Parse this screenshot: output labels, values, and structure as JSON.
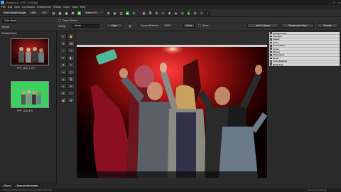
{
  "window": {
    "title": "Photokey 8 - [FPP_0138.jpg]",
    "controls": [
      "–",
      "□",
      "×"
    ]
  },
  "menu": [
    "File",
    "Edit",
    "View",
    "Corrections",
    "Environment",
    "Effects",
    "Layer",
    "Tools",
    "Help"
  ],
  "toolbar": {
    "mode": "Select Multiple Images",
    "width": "1280",
    "height": "720",
    "zoom": "Scale to Fit"
  },
  "subtoolbar": {
    "label_color": "Color Match",
    "label_despill": "Despill",
    "label_setting": "Setting",
    "setting_value": "Whole",
    "screen_checkbox_label": "Green Screen",
    "open_button": "Open",
    "current_selection_label": "Current Selection",
    "current_selection_value": "GREE",
    "clear_button": "Clear",
    "same_label": "Same",
    "add_to_queue": "Add To Queue",
    "synchronize": "Synchronize Keys",
    "browse": "Browse"
  },
  "left_panel": {
    "title": "Selected Items",
    "thumbs": [
      {
        "caption": "FPP_0138_1.JPG"
      },
      {
        "caption": "FPP_0138.JPG"
      }
    ],
    "bottom_buttons": [
      "Open",
      "Save as New Image"
    ]
  },
  "layers": [
    {
      "label": "Backgrounds",
      "color": "#e04040"
    },
    {
      "label": "Overlays",
      "color": "#3070d0"
    },
    {
      "label": "Adjust",
      "color": "#60b060"
    },
    {
      "label": "Color",
      "color": "#e09030"
    },
    {
      "label": "Corrections",
      "color": "#c050c0"
    },
    {
      "label": "Crops",
      "color": "#5090e0"
    },
    {
      "label": "Effects",
      "color": "#d0d040"
    },
    {
      "label": "Chromakey",
      "color": "#40c0c0"
    },
    {
      "label": "Blank",
      "color": "#e06060"
    },
    {
      "label": "Color Balance",
      "color": "#8080e0"
    },
    {
      "label": "Mask Text",
      "color": "#a0a0a0"
    }
  ],
  "status": {
    "path": "C:\\Photokey8\\Samples\\Green Screen\\FPP_0138.JPG",
    "right": "Greenscreen Ready"
  }
}
